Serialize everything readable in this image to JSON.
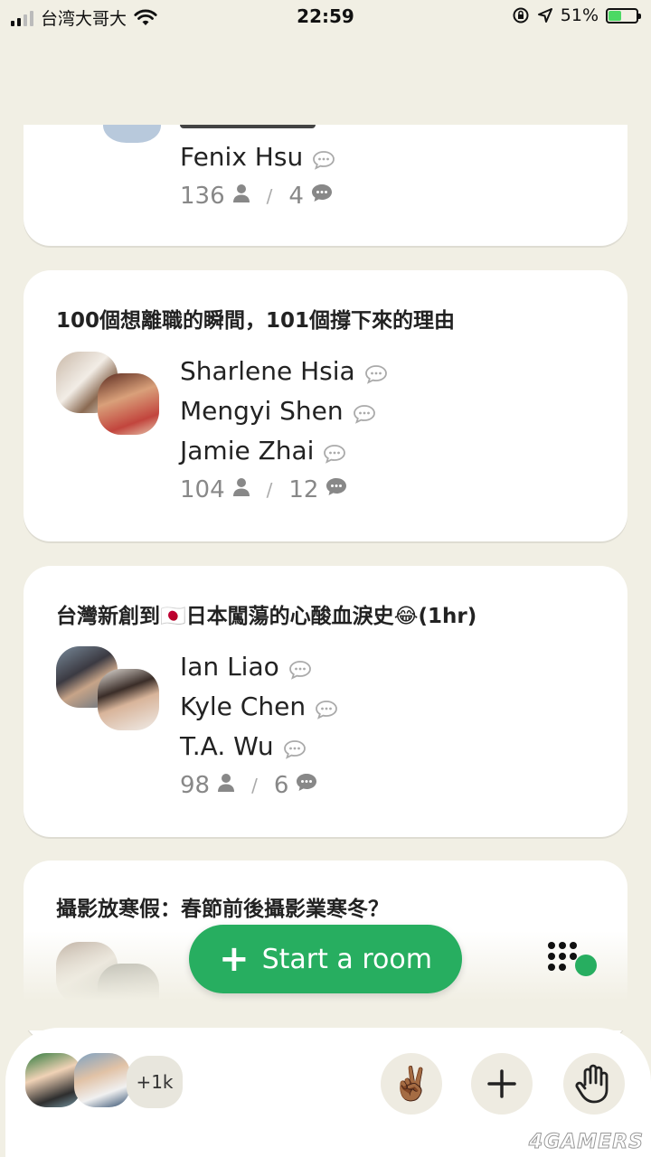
{
  "status_bar": {
    "carrier": "台湾大哥大",
    "time": "22:59",
    "battery": "51%",
    "battery_level": 0.51
  },
  "rooms": [
    {
      "speakers": [
        "Fenix Hsu"
      ],
      "listeners": "136",
      "comments": "4"
    },
    {
      "title": "100個想離職的瞬間，101個撐下來的理由",
      "speakers": [
        "Sharlene Hsia",
        "Mengyi Shen",
        "Jamie Zhai"
      ],
      "listeners": "104",
      "comments": "12"
    },
    {
      "title": "台灣新創到🇯🇵日本闖蕩的心酸血淚史😂(1hr)",
      "speakers": [
        "Ian Liao",
        "Kyle Chen",
        "T.A. Wu"
      ],
      "listeners": "98",
      "comments": "6"
    },
    {
      "title": "攝影放寒假：春節前後攝影業寒冬？"
    }
  ],
  "actions": {
    "start_room": "Start a room",
    "plus": "+"
  },
  "bottom": {
    "more_count": "+1k",
    "peace_emoji": "✌🏾"
  },
  "watermark": "4GAMERS",
  "colors": {
    "background": "#f1efe4",
    "accent_green": "#27ae60"
  }
}
